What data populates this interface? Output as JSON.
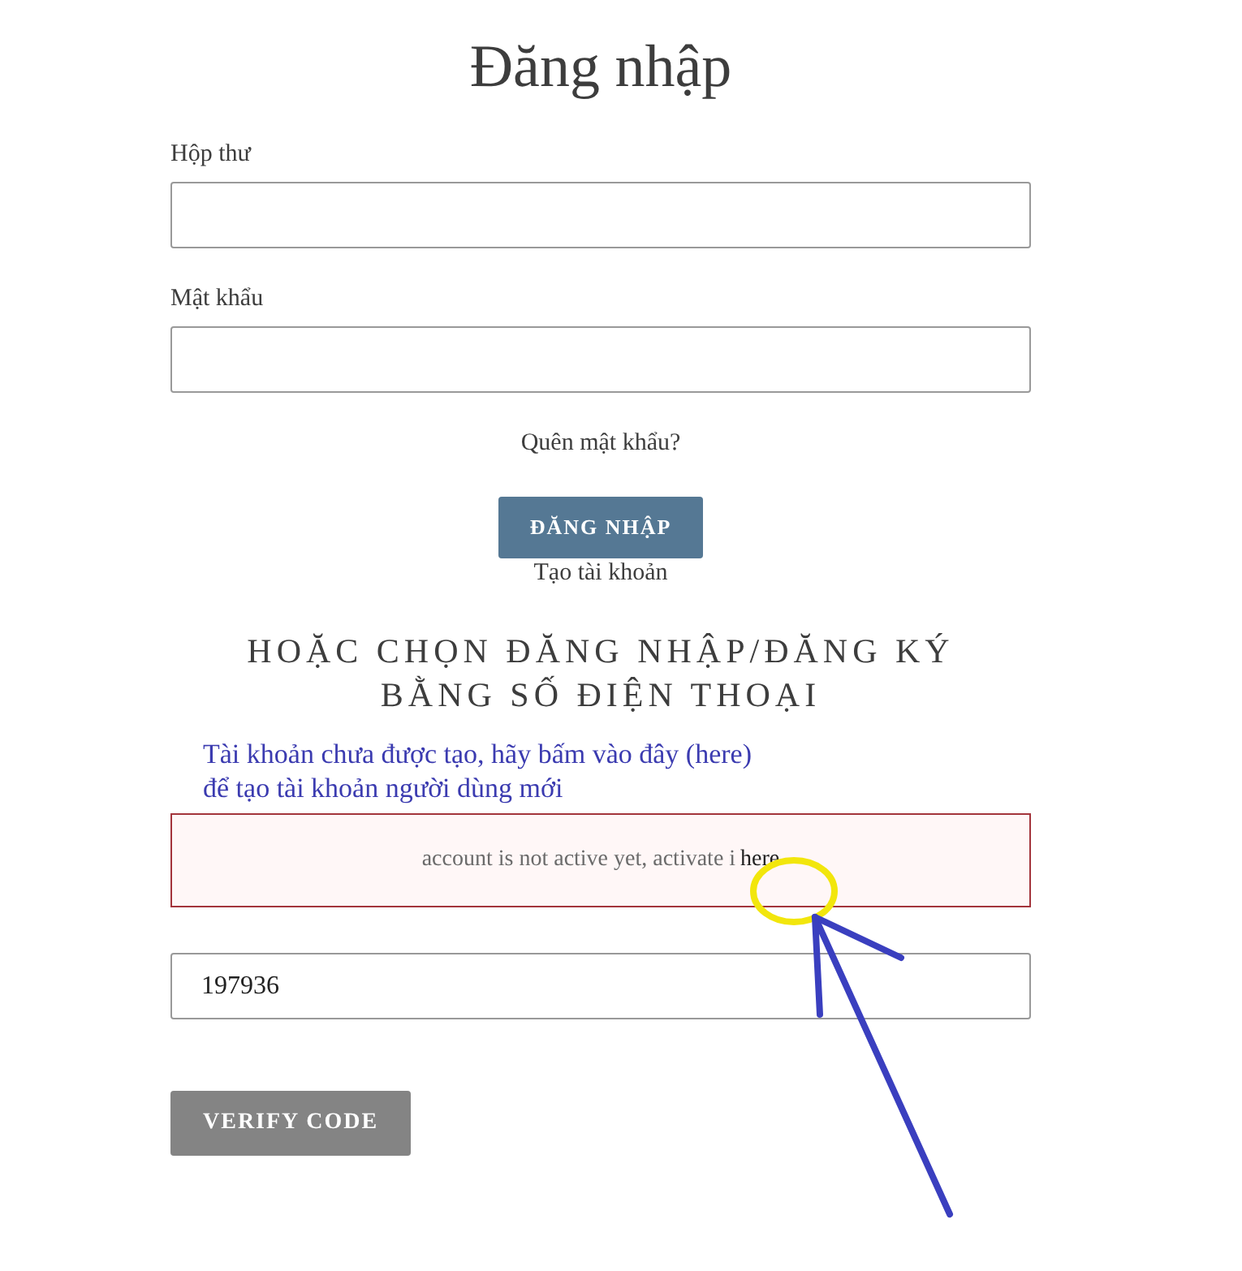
{
  "title": "Đăng nhập",
  "fields": [
    {
      "label": "Hộp thư"
    },
    {
      "label": "Mật khẩu"
    }
  ],
  "forgot_link": "Quên mật khẩu?",
  "login_button": "ĐĂNG NHẬP",
  "create_account_link": "Tạo tài khoản",
  "phone_heading": "HOẶC CHỌN ĐĂNG NHẬP/ĐĂNG KÝ BẰNG SỐ ĐIỆN THOẠI",
  "annotation_note": "Tài khoản chưa được tạo, hãy bấm vào đây (here) để tạo tài khoản người dùng mới",
  "alert": {
    "text": "account is not active yet, activate i",
    "link": "here"
  },
  "code_field": {
    "value": "197936"
  },
  "verify_button": "VERIFY CODE"
}
